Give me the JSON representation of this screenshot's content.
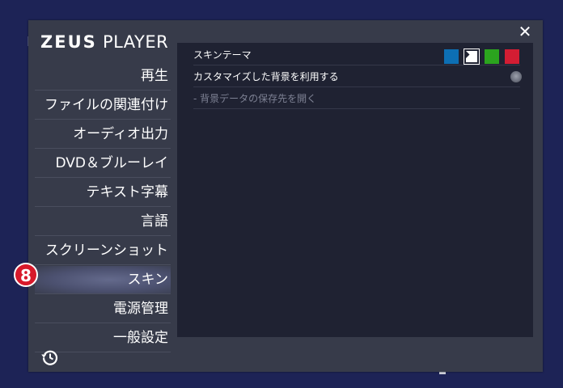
{
  "window": {
    "logo_brand": "ZEUS",
    "logo_suffix": "PLAYER",
    "close_label": "✕"
  },
  "sidebar": {
    "items": [
      {
        "label": "再生",
        "active": false
      },
      {
        "label": "ファイルの関連付け",
        "active": false
      },
      {
        "label": "オーディオ出力",
        "active": false
      },
      {
        "label": "DVD＆ブルーレイ",
        "active": false
      },
      {
        "label": "テキスト字幕",
        "active": false
      },
      {
        "label": "言語",
        "active": false
      },
      {
        "label": "スクリーンショット",
        "active": false
      },
      {
        "label": "スキン",
        "active": true
      },
      {
        "label": "電源管理",
        "active": false
      },
      {
        "label": "一般設定",
        "active": false
      }
    ],
    "annotation_badge": "8",
    "history_icon": "history-icon"
  },
  "content": {
    "skin_theme_label": "スキンテーマ",
    "custom_background_label": "カスタマイズした背景を利用する",
    "open_folder_label": "- 背景データの保存先を開く",
    "theme_colors": [
      "#0d6fb4",
      "#ffffff",
      "#2ba41e",
      "#d31d33"
    ],
    "selected_theme": 1
  }
}
